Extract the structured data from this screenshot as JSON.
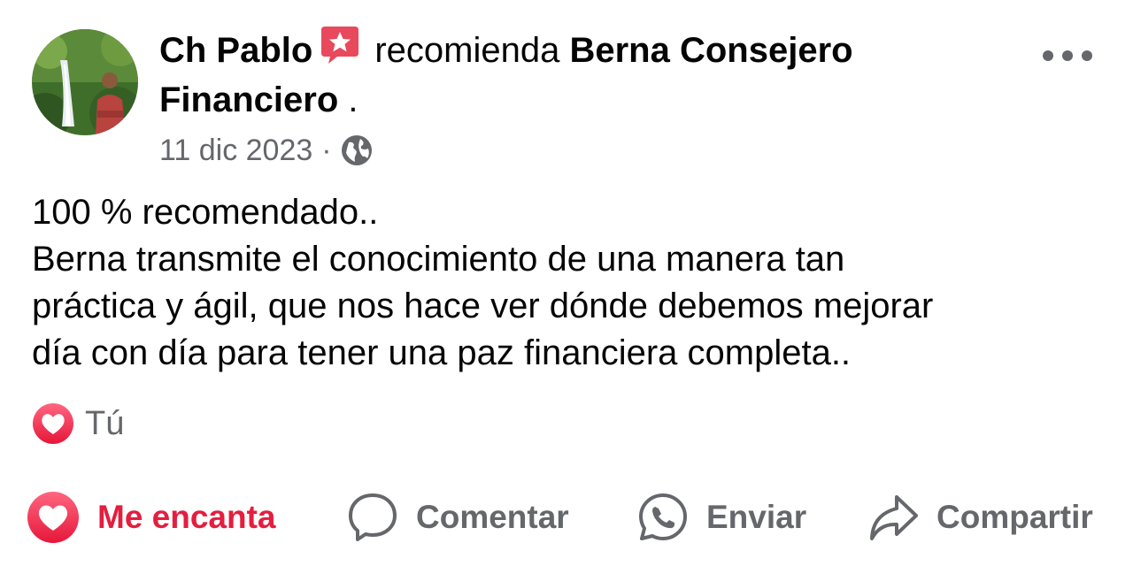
{
  "post": {
    "author": "Ch Pablo",
    "verb": "recomienda",
    "page_name_line1": "Berna Consejero",
    "page_name_line2": "Financiero",
    "trailing": ".",
    "date": "11 dic 2023",
    "dot": "·",
    "body": [
      "100 % recomendado..",
      "Berna transmite el conocimiento de una manera tan",
      "práctica y ágil, que nos hace ver dónde debemos mejorar",
      "día con día para tener una paz financiera completa.."
    ],
    "reaction_user": "Tú"
  },
  "actions": {
    "love_label": "Me encanta",
    "comment_label": "Comentar",
    "send_label": "Enviar",
    "share_label": "Compartir"
  },
  "icons": {
    "recommend": "recommend-star-badge-icon",
    "privacy": "globe-icon",
    "more": "more-options-icon",
    "love": "love-heart-icon",
    "comment": "comment-bubble-icon",
    "send": "whatsapp-icon",
    "share": "share-arrow-icon"
  },
  "colors": {
    "love": "#e41e3f",
    "secondary_text": "#65676b",
    "badge": "#e8495d"
  }
}
